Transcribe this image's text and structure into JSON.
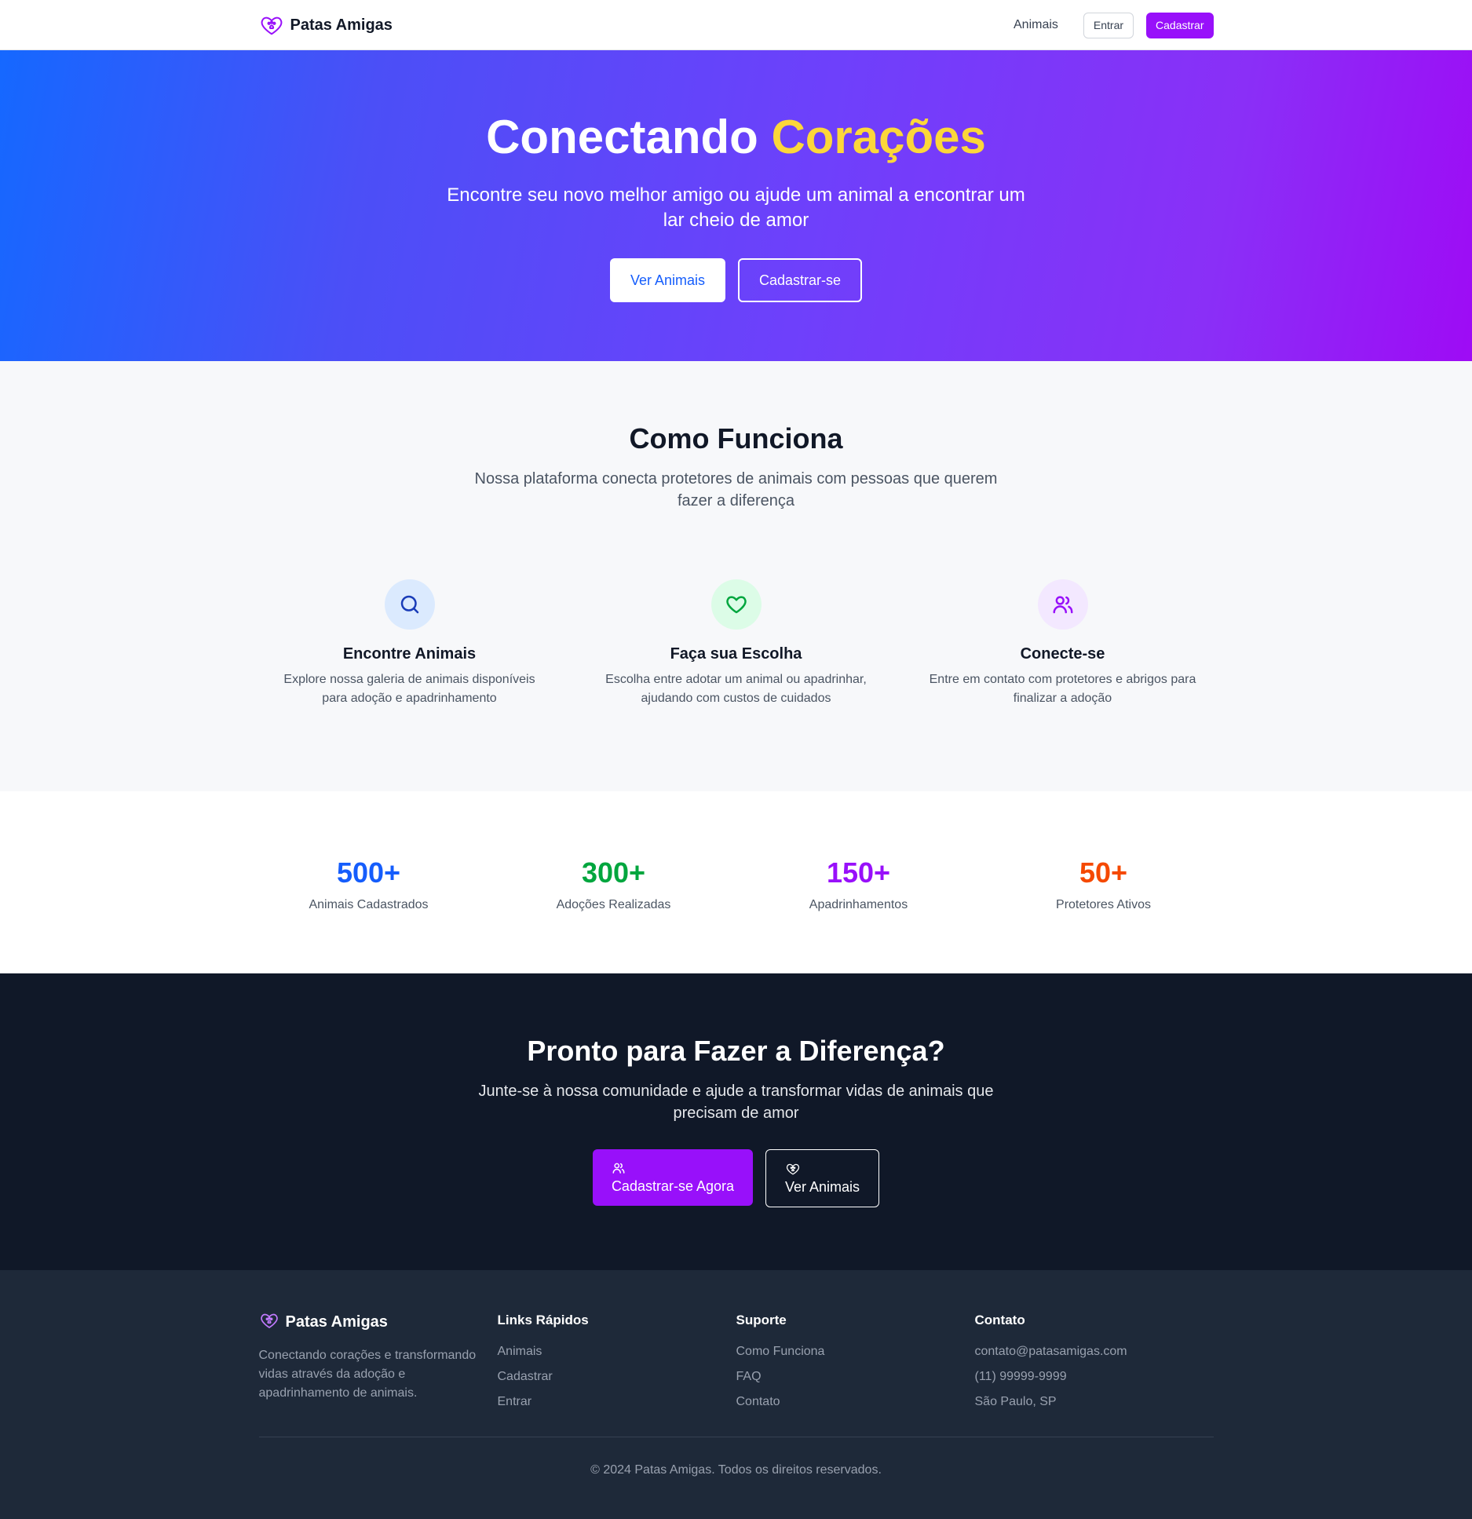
{
  "nav": {
    "brand": "Patas Amigas",
    "link_animals": "Animais",
    "login": "Entrar",
    "signup": "Cadastrar"
  },
  "hero": {
    "title_part1": "Conectando ",
    "title_accent": "Corações",
    "subtitle": "Encontre seu novo melhor amigo ou ajude um animal a encontrar um lar cheio de amor",
    "btn_primary": "Ver Animais",
    "btn_secondary": "Cadastrar-se"
  },
  "how": {
    "title": "Como Funciona",
    "subtitle": "Nossa plataforma conecta protetores de animais com pessoas que querem fazer a diferença",
    "steps": [
      {
        "icon": "search-icon",
        "title": "Encontre Animais",
        "desc": "Explore nossa galeria de animais disponíveis para adoção e apadrinhamento"
      },
      {
        "icon": "heart-icon",
        "title": "Faça sua Escolha",
        "desc": "Escolha entre adotar um animal ou apadrinhar, ajudando com custos de cuidados"
      },
      {
        "icon": "users-icon",
        "title": "Conecte-se",
        "desc": "Entre em contato com protetores e abrigos para finalizar a adoção"
      }
    ]
  },
  "stats": [
    {
      "value": "500+",
      "label": "Animais Cadastrados",
      "color": "#155dfc"
    },
    {
      "value": "300+",
      "label": "Adoções Realizadas",
      "color": "#00a63e"
    },
    {
      "value": "150+",
      "label": "Apadrinhamentos",
      "color": "#9810fa"
    },
    {
      "value": "50+",
      "label": "Protetores Ativos",
      "color": "#f54900"
    }
  ],
  "cta": {
    "title": "Pronto para Fazer a Diferença?",
    "subtitle": "Junte-se à nossa comunidade e ajude a transformar vidas de animais que precisam de amor",
    "btn_primary": "Cadastrar-se Agora",
    "btn_secondary": "Ver Animais"
  },
  "footer": {
    "brand": "Patas Amigas",
    "brand_text": "Conectando corações e transformando vidas através da adoção e apadrinhamento de animais.",
    "quick_links_title": "Links Rápidos",
    "quick_links": [
      "Animais",
      "Cadastrar",
      "Entrar"
    ],
    "support_title": "Suporte",
    "support_links": [
      "Como Funciona",
      "FAQ",
      "Contato"
    ],
    "contact_title": "Contato",
    "contact_items": [
      "contato@patasamigas.com",
      "(11) 99999-9999",
      "São Paulo, SP"
    ],
    "copyright": "© 2024 Patas Amigas. Todos os direitos reservados."
  },
  "colors": {
    "brand_purple": "#9810fa",
    "hero_gradient_start": "#1568ff",
    "hero_gradient_end": "#9e0bf5",
    "hero_accent": "#fcd73a",
    "cta_bg": "#101828",
    "footer_bg": "#1e2939"
  }
}
